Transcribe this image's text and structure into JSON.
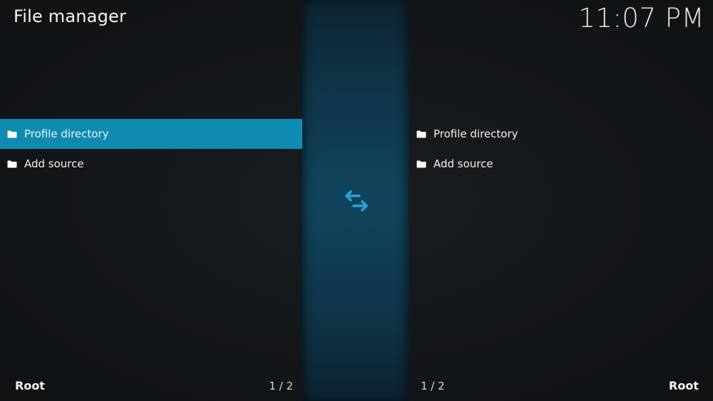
{
  "header": {
    "title": "File manager",
    "clock": "11:07 PM"
  },
  "colors": {
    "accent": "#0f8bb1",
    "center_bar": "#10455d",
    "swap_icon": "#29a3d1",
    "background": "#131619"
  },
  "left_pane": {
    "items": [
      {
        "label": "Profile directory",
        "icon": "folder-icon",
        "focused": true
      },
      {
        "label": "Add source",
        "icon": "folder-icon",
        "focused": false
      }
    ],
    "path": "Root",
    "count": "1 / 2"
  },
  "right_pane": {
    "items": [
      {
        "label": "Profile directory",
        "icon": "folder-icon",
        "focused": false
      },
      {
        "label": "Add source",
        "icon": "folder-icon",
        "focused": false
      }
    ],
    "path": "Root",
    "count": "1 / 2"
  },
  "center": {
    "icon": "swap-arrows-icon"
  }
}
